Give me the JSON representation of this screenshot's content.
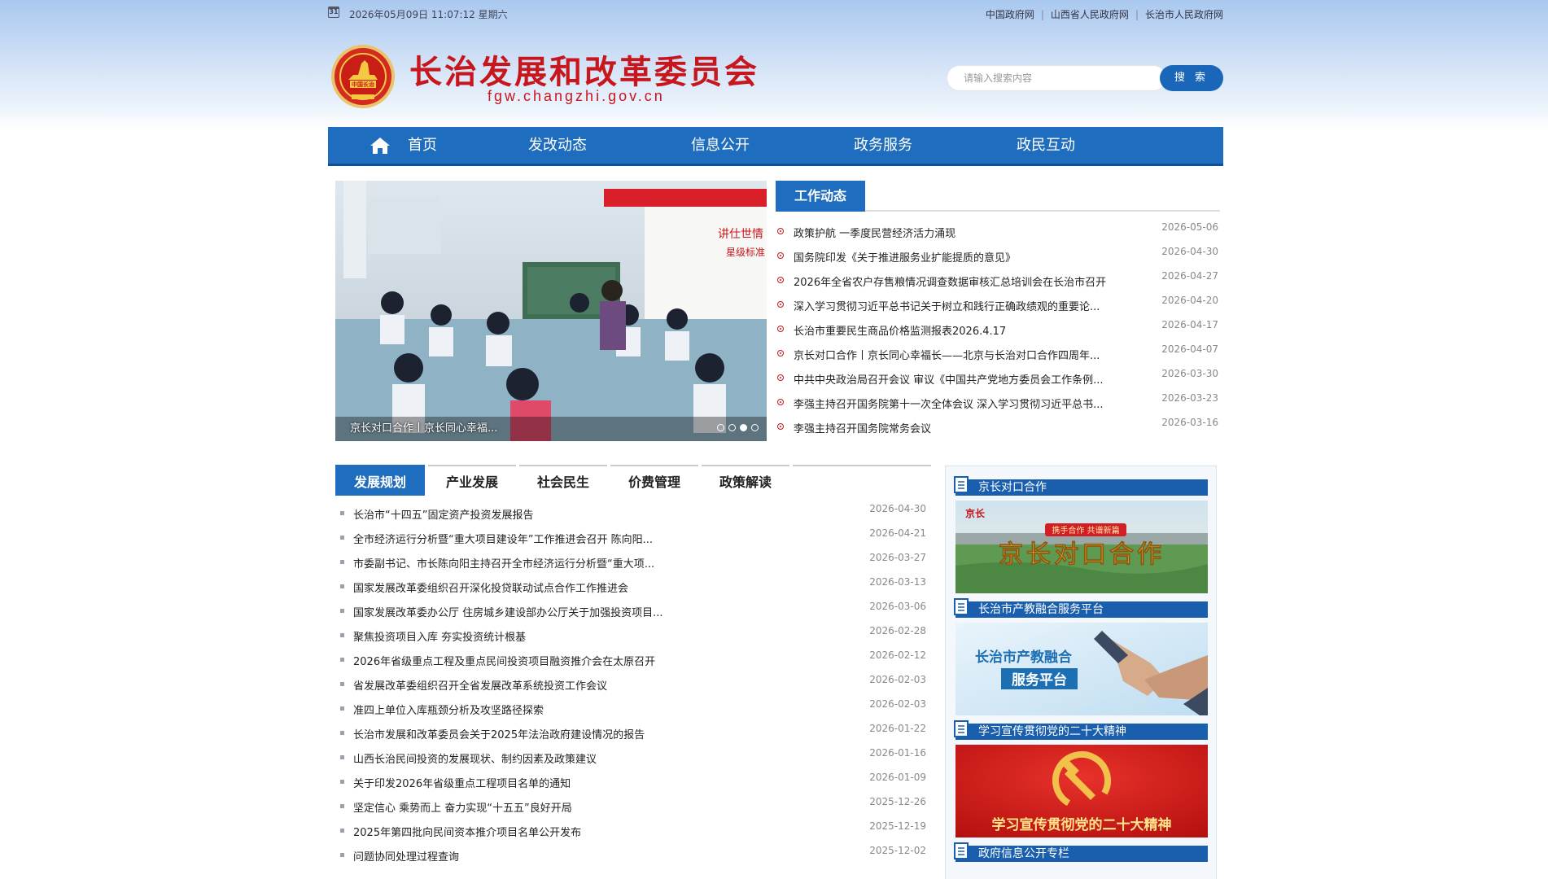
{
  "topbar": {
    "datetime": "2026年05月09日 11:07:12 星期六",
    "calendar_icon_text": "31",
    "links": [
      "中国政府网",
      "山西省人民政府网",
      "长治市人民政府网"
    ]
  },
  "header": {
    "logo_text_top": "中国长治",
    "title": "长治发展和改革委员会",
    "domain": "fgw.changzhi.gov.cn"
  },
  "search": {
    "placeholder": "请输入搜索内容",
    "button": "搜 索"
  },
  "nav": {
    "items": [
      "首页",
      "发改动态",
      "信息公开",
      "政务服务",
      "政民互动"
    ]
  },
  "slideshow": {
    "caption": "京长对口合作丨京长同心幸福...",
    "dots": 4,
    "active_dot": 3,
    "board_text_1": "讲仕世情",
    "board_text_2": "星级标准"
  },
  "work_news": {
    "tab": "工作动态",
    "items": [
      {
        "title": "政策护航 一季度民营经济活力涌现",
        "date": "2026-05-06"
      },
      {
        "title": "国务院印发《关于推进服务业扩能提质的意见》",
        "date": "2026-04-30"
      },
      {
        "title": "2026年全省农户存售粮情况调查数据审核汇总培训会在长治市召开",
        "date": "2026-04-27"
      },
      {
        "title": "深入学习贯彻习近平总书记关于树立和践行正确政绩观的重要论...",
        "date": "2026-04-20"
      },
      {
        "title": "长治市重要民生商品价格监测报表2026.4.17",
        "date": "2026-04-17"
      },
      {
        "title": "京长对口合作丨京长同心幸福长——北京与长治对口合作四周年...",
        "date": "2026-04-07"
      },
      {
        "title": "中共中央政治局召开会议 审议《中国共产党地方委员会工作条例...",
        "date": "2026-03-30"
      },
      {
        "title": "李强主持召开国务院第十一次全体会议 深入学习贯彻习近平总书...",
        "date": "2026-03-23"
      },
      {
        "title": "李强主持召开国务院常务会议",
        "date": "2026-03-16"
      }
    ]
  },
  "categories": {
    "tabs": [
      "发展规划",
      "产业发展",
      "社会民生",
      "价费管理",
      "政策解读"
    ],
    "active": 0,
    "items": [
      {
        "title": "长治市“十四五”固定资产投资发展报告",
        "date": "2026-04-30"
      },
      {
        "title": "全市经济运行分析暨“重大项目建设年”工作推进会召开 陈向阳...",
        "date": "2026-04-21"
      },
      {
        "title": "市委副书记、市长陈向阳主持召开全市经济运行分析暨“重大项...",
        "date": "2026-03-27"
      },
      {
        "title": "国家发展改革委组织召开深化投贷联动试点合作工作推进会",
        "date": "2026-03-13"
      },
      {
        "title": "国家发展改革委办公厅 住房城乡建设部办公厅关于加强投资项目...",
        "date": "2026-03-06"
      },
      {
        "title": "聚焦投资项目入库     夯实投资统计根基",
        "date": "2026-02-28"
      },
      {
        "title": "2026年省级重点工程及重点民间投资项目融资推介会在太原召开",
        "date": "2026-02-12"
      },
      {
        "title": "省发展改革委组织召开全省发展改革系统投资工作会议",
        "date": "2026-02-03"
      },
      {
        "title": "准四上单位入库瓶颈分析及攻坚路径探索",
        "date": "2026-02-03"
      },
      {
        "title": "长治市发展和改革委员会关于2025年法治政府建设情况的报告",
        "date": "2026-01-22"
      },
      {
        "title": "山西长治民间投资的发展现状、制约因素及政策建议",
        "date": "2026-01-16"
      },
      {
        "title": "关于印发2026年省级重点工程项目名单的通知",
        "date": "2026-01-09"
      },
      {
        "title": "坚定信心 乘势而上 奋力实现“十五五”良好开局",
        "date": "2025-12-26"
      },
      {
        "title": "2025年第四批向民间资本推介项目名单公开发布",
        "date": "2025-12-19"
      },
      {
        "title": "问题协同处理过程查询",
        "date": "2025-12-02"
      }
    ]
  },
  "side": {
    "sections": [
      {
        "title": "京长对口合作",
        "banner_small": "京长",
        "banner_tag": "携手合作 共谱新篇",
        "banner_main": "京长对口合作"
      },
      {
        "title": "长治市产教融合服务平台",
        "banner_line1": "长治市产教融合",
        "banner_line2": "服务平台"
      },
      {
        "title": "学习宣传贯彻党的二十大精神",
        "banner_main": "学习宣传贯彻党的二十大精神"
      },
      {
        "title": "政府信息公开专栏"
      }
    ]
  },
  "colors": {
    "brand_blue": "#1f6dbe",
    "title_red": "#c8161d",
    "side_head_blue": "#1a5fae"
  }
}
